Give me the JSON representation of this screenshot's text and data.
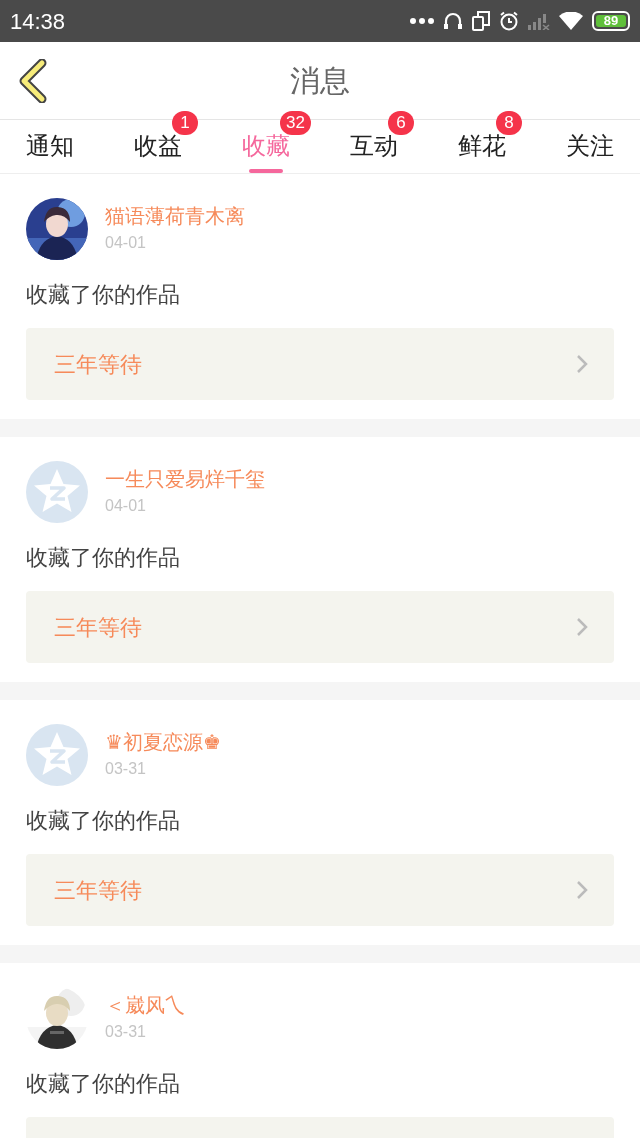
{
  "status_bar": {
    "time": "14:38",
    "battery": "89"
  },
  "header": {
    "title": "消息"
  },
  "tabs": [
    {
      "label": "通知",
      "selected": false
    },
    {
      "label": "收益",
      "selected": false,
      "badge": "1"
    },
    {
      "label": "收藏",
      "selected": true,
      "badge": "32"
    },
    {
      "label": "互动",
      "selected": false,
      "badge": "6"
    },
    {
      "label": "鲜花",
      "selected": false,
      "badge": "8"
    },
    {
      "label": "关注",
      "selected": false
    }
  ],
  "messages": [
    {
      "name": "猫语薄荷青木离",
      "date": "04-01",
      "action": "收藏了你的作品",
      "work": "三年等待"
    },
    {
      "avatar": {
        "kind": "default"
      },
      "name": "一生只爱易烊千玺",
      "date": "04-01",
      "action": "收藏了你的作品",
      "work": "三年等待"
    },
    {
      "avatar": {
        "kind": "default"
      },
      "name": "♛初夏恋源♚",
      "date": "03-31",
      "action": "收藏了你的作品",
      "work": "三年等待"
    },
    {
      "name": "＜崴风乀",
      "date": "03-31",
      "action": "收藏了你的作品"
    }
  ]
}
